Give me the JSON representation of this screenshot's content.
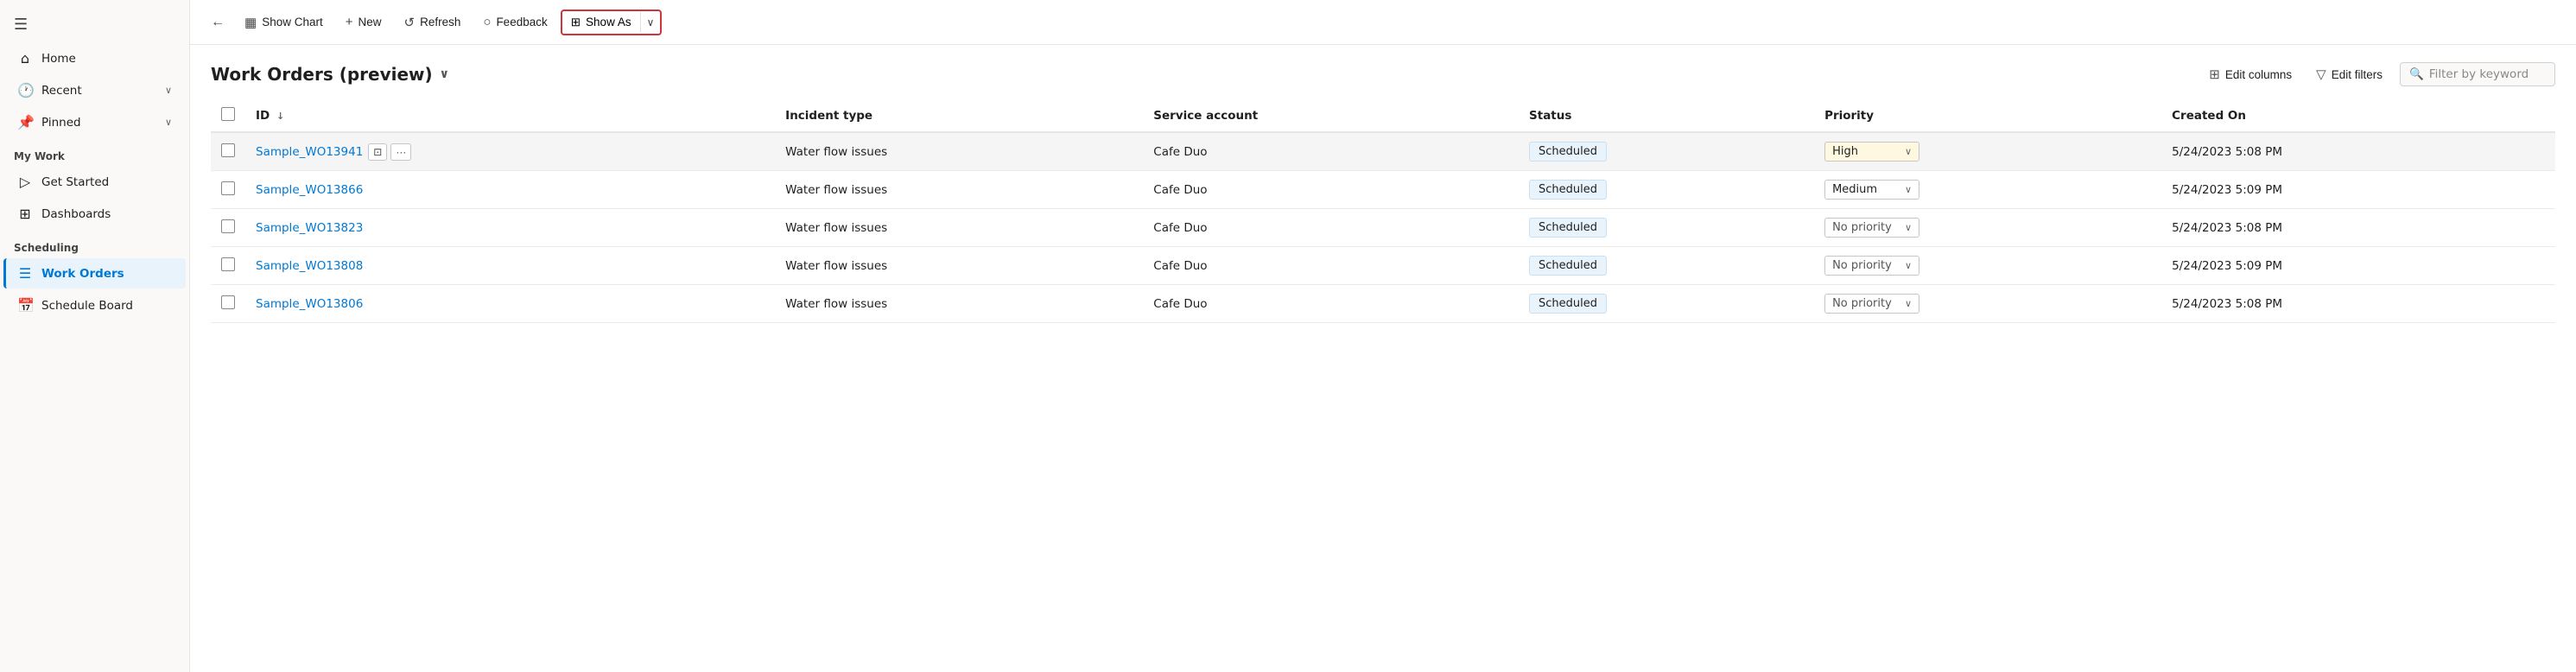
{
  "sidebar": {
    "hamburger_icon": "☰",
    "items": [
      {
        "id": "home",
        "label": "Home",
        "icon": "⌂",
        "active": false,
        "chevron": ""
      },
      {
        "id": "recent",
        "label": "Recent",
        "icon": "🕐",
        "active": false,
        "chevron": "∨"
      },
      {
        "id": "pinned",
        "label": "Pinned",
        "icon": "📌",
        "active": false,
        "chevron": "∨"
      }
    ],
    "my_work_section": "My Work",
    "my_work_items": [
      {
        "id": "get-started",
        "label": "Get Started",
        "icon": "▷",
        "active": false
      },
      {
        "id": "dashboards",
        "label": "Dashboards",
        "icon": "⊞",
        "active": false
      }
    ],
    "scheduling_section": "Scheduling",
    "scheduling_items": [
      {
        "id": "work-orders",
        "label": "Work Orders",
        "icon": "☰",
        "active": true
      },
      {
        "id": "schedule-board",
        "label": "Schedule Board",
        "icon": "📅",
        "active": false
      }
    ]
  },
  "toolbar": {
    "back_icon": "←",
    "show_chart_label": "Show Chart",
    "show_chart_icon": "▦",
    "new_label": "New",
    "new_icon": "+",
    "refresh_label": "Refresh",
    "refresh_icon": "↺",
    "feedback_label": "Feedback",
    "feedback_icon": "○",
    "show_as_label": "Show As",
    "show_as_icon": "⊞",
    "show_as_dropdown_icon": "∨"
  },
  "content": {
    "title": "Work Orders (preview)",
    "title_chevron": "∨",
    "edit_columns_label": "Edit columns",
    "edit_columns_icon": "⊞",
    "edit_filters_label": "Edit filters",
    "edit_filters_icon": "▽",
    "filter_placeholder": "Filter by keyword",
    "filter_icon": "🔍"
  },
  "table": {
    "columns": [
      {
        "id": "id",
        "label": "ID",
        "sortable": true,
        "sort_icon": "↓"
      },
      {
        "id": "incident_type",
        "label": "Incident type",
        "sortable": false
      },
      {
        "id": "service_account",
        "label": "Service account",
        "sortable": false
      },
      {
        "id": "status",
        "label": "Status",
        "sortable": false
      },
      {
        "id": "priority",
        "label": "Priority",
        "sortable": false
      },
      {
        "id": "created_on",
        "label": "Created On",
        "sortable": false
      }
    ],
    "rows": [
      {
        "id": "Sample_WO13941",
        "incident_type": "Water flow issues",
        "service_account": "Cafe Duo",
        "status": "Scheduled",
        "priority": "High",
        "priority_class": "high",
        "created_on": "5/24/2023 5:08 PM",
        "has_actions": true
      },
      {
        "id": "Sample_WO13866",
        "incident_type": "Water flow issues",
        "service_account": "Cafe Duo",
        "status": "Scheduled",
        "priority": "Medium",
        "priority_class": "medium",
        "created_on": "5/24/2023 5:09 PM",
        "has_actions": false
      },
      {
        "id": "Sample_WO13823",
        "incident_type": "Water flow issues",
        "service_account": "Cafe Duo",
        "status": "Scheduled",
        "priority": "No priority",
        "priority_class": "no-priority",
        "created_on": "5/24/2023 5:08 PM",
        "has_actions": false
      },
      {
        "id": "Sample_WO13808",
        "incident_type": "Water flow issues",
        "service_account": "Cafe Duo",
        "status": "Scheduled",
        "priority": "No priority",
        "priority_class": "no-priority",
        "created_on": "5/24/2023 5:09 PM",
        "has_actions": false
      },
      {
        "id": "Sample_WO13806",
        "incident_type": "Water flow issues",
        "service_account": "Cafe Duo",
        "status": "Scheduled",
        "priority": "No priority",
        "priority_class": "no-priority",
        "created_on": "5/24/2023 5:08 PM",
        "has_actions": false
      }
    ]
  }
}
